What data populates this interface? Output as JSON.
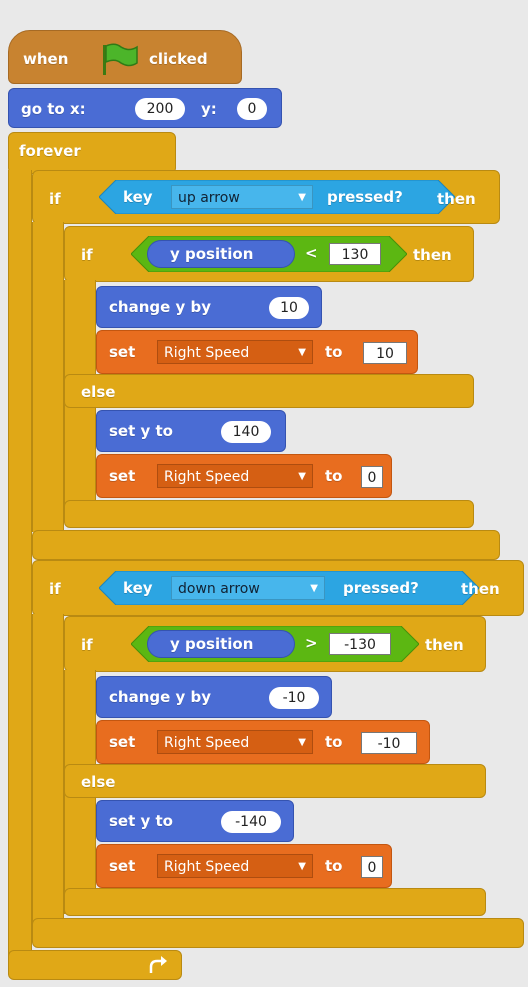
{
  "hat": {
    "when": "when",
    "clicked": "clicked",
    "flag_icon": "green-flag-icon"
  },
  "goto": {
    "label1": "go to x:",
    "x": "200",
    "label2": "y:",
    "y": "0"
  },
  "forever": {
    "label": "forever",
    "repeat_icon": "loop-arrow-icon"
  },
  "if_up": {
    "if": "if",
    "key": "key",
    "key_value": "up arrow",
    "pressed": "pressed?",
    "then": "then",
    "inner_if": "if",
    "ypos": "y position",
    "op": "<",
    "value": "130",
    "inner_then": "then",
    "change_label": "change y by",
    "change_value": "10",
    "set1_label": "set",
    "set1_var": "Right Speed",
    "set1_to": "to",
    "set1_value": "10",
    "else": "else",
    "sety_label": "set y to",
    "sety_value": "140",
    "set2_label": "set",
    "set2_var": "Right Speed",
    "set2_to": "to",
    "set2_value": "0"
  },
  "if_down": {
    "if": "if",
    "key": "key",
    "key_value": "down arrow",
    "pressed": "pressed?",
    "then": "then",
    "inner_if": "if",
    "ypos": "y position",
    "op": ">",
    "value": "-130",
    "inner_then": "then",
    "change_label": "change y by",
    "change_value": "-10",
    "set1_label": "set",
    "set1_var": "Right Speed",
    "set1_to": "to",
    "set1_value": "-10",
    "else": "else",
    "sety_label": "set y to",
    "sety_value": "-140",
    "set2_label": "set",
    "set2_var": "Right Speed",
    "set2_to": "to",
    "set2_value": "0"
  },
  "colors": {
    "control": "#e0a817",
    "events": "#c88330",
    "motion": "#4a6cd4",
    "data": "#e86d1f",
    "sensing": "#2ca5e2",
    "operators": "#5cb712"
  }
}
